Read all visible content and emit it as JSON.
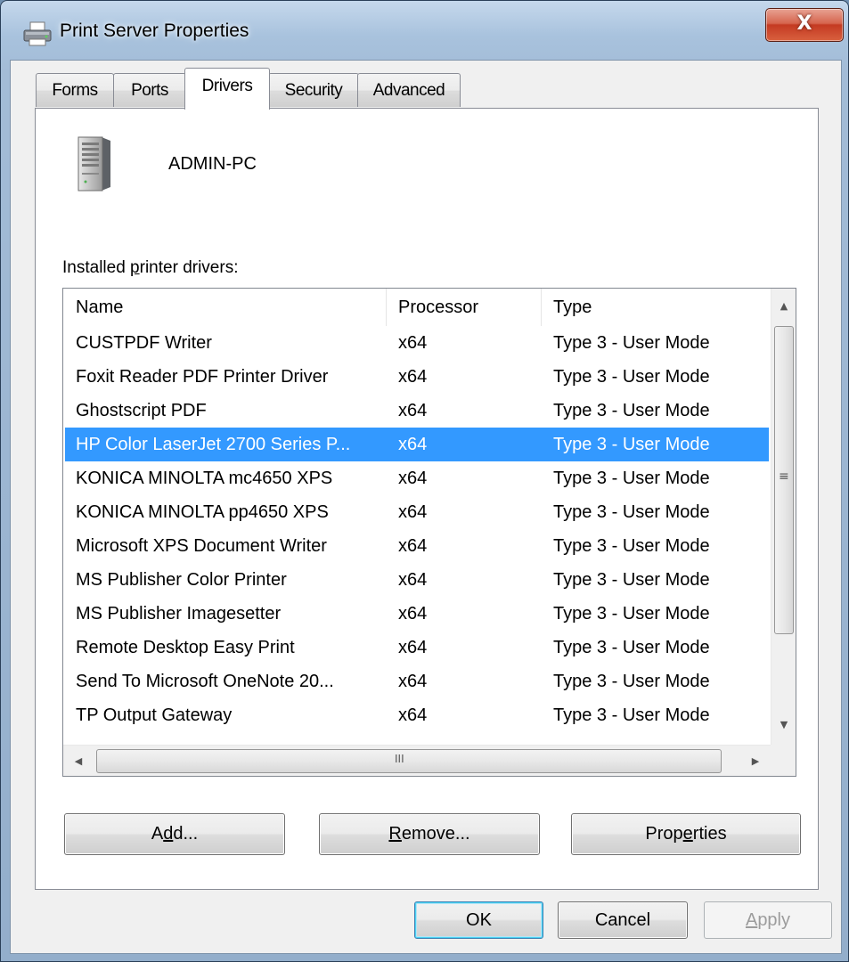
{
  "window": {
    "title": "Print Server Properties",
    "close_glyph": "X"
  },
  "tabs": [
    {
      "label": "Forms"
    },
    {
      "label": "Ports"
    },
    {
      "label": "Drivers",
      "active": true
    },
    {
      "label": "Security"
    },
    {
      "label": "Advanced"
    }
  ],
  "server": {
    "name": "ADMIN-PC",
    "icon": "server-tower-icon"
  },
  "drivers": {
    "label_before": "Installed ",
    "label_accel": "p",
    "label_after": "rinter drivers:",
    "columns": {
      "name": "Name",
      "processor": "Processor",
      "type": "Type"
    },
    "rows": [
      {
        "name": "CUSTPDF Writer",
        "processor": "x64",
        "type": "Type 3 - User Mode"
      },
      {
        "name": "Foxit Reader PDF Printer Driver",
        "processor": "x64",
        "type": "Type 3 - User Mode"
      },
      {
        "name": "Ghostscript PDF",
        "processor": "x64",
        "type": "Type 3 - User Mode"
      },
      {
        "name": "HP Color LaserJet 2700 Series P...",
        "processor": "x64",
        "type": "Type 3 - User Mode",
        "selected": true
      },
      {
        "name": "KONICA MINOLTA mc4650 XPS",
        "processor": "x64",
        "type": "Type 3 - User Mode"
      },
      {
        "name": "KONICA MINOLTA pp4650 XPS",
        "processor": "x64",
        "type": "Type 3 - User Mode"
      },
      {
        "name": "Microsoft XPS Document Writer",
        "processor": "x64",
        "type": "Type 3 - User Mode"
      },
      {
        "name": "MS Publisher Color Printer",
        "processor": "x64",
        "type": "Type 3 - User Mode"
      },
      {
        "name": "MS Publisher Imagesetter",
        "processor": "x64",
        "type": "Type 3 - User Mode"
      },
      {
        "name": "Remote Desktop Easy Print",
        "processor": "x64",
        "type": "Type 3 - User Mode"
      },
      {
        "name": "Send To Microsoft OneNote 20...",
        "processor": "x64",
        "type": "Type 3 - User Mode"
      },
      {
        "name": "TP Output Gateway",
        "processor": "x64",
        "type": "Type 3 - User Mode"
      }
    ]
  },
  "scrollbar_glyphs": {
    "up": "▲",
    "down": "▼",
    "left": "◀",
    "right": "▶",
    "vgrip": "≡",
    "hgrip": "III"
  },
  "buttons": {
    "add": {
      "before": "A",
      "accel": "d",
      "after": "d..."
    },
    "remove": {
      "before": "",
      "accel": "R",
      "after": "emove..."
    },
    "properties": {
      "before": "Prop",
      "accel": "e",
      "after": "rties"
    },
    "ok": {
      "label": "OK"
    },
    "cancel": {
      "label": "Cancel"
    },
    "apply": {
      "before": "",
      "accel": "A",
      "after": "pply"
    }
  },
  "colors": {
    "selection": "#3399ff",
    "titlebar": "#a8c2dd",
    "close_button": "#c43a22"
  }
}
